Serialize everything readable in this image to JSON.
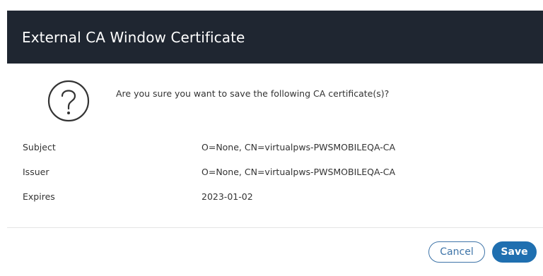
{
  "dialog": {
    "title": "External CA Window Certificate",
    "question_icon": "question-circle-icon",
    "message": "Are you sure you want to save the following CA certificate(s)?"
  },
  "certificate": [
    {
      "label": "Subject",
      "value": "O=None, CN=virtualpws-PWSMOBILEQA-CA"
    },
    {
      "label": "Issuer",
      "value": "O=None, CN=virtualpws-PWSMOBILEQA-CA"
    },
    {
      "label": "Expires",
      "value": "2023-01-02"
    }
  ],
  "buttons": {
    "cancel_label": "Cancel",
    "save_label": "Save"
  },
  "colors": {
    "header_bg": "#1f2631",
    "primary": "#1f6fb0",
    "link": "#3e74a8"
  }
}
